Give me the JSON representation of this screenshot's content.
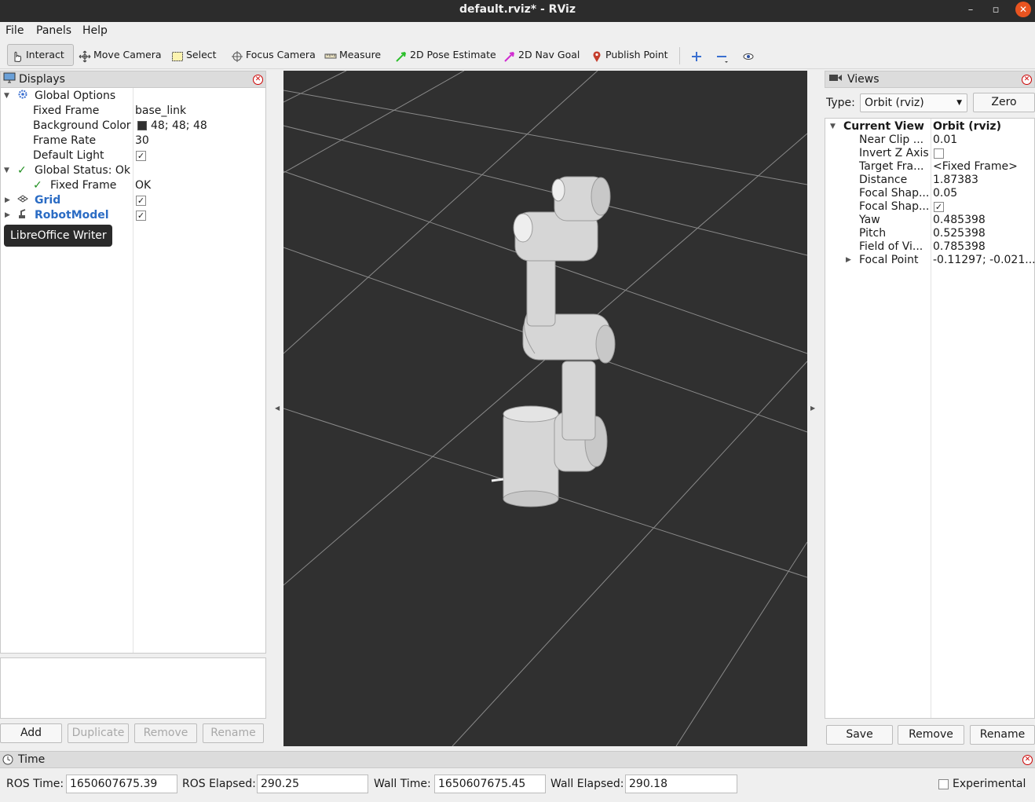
{
  "window": {
    "title": "default.rviz* - RViz",
    "minimize": "–",
    "maximize": "▫",
    "close": "✕"
  },
  "menu": {
    "file": "File",
    "panels": "Panels",
    "help": "Help"
  },
  "toolbar": {
    "interact": "Interact",
    "move_camera": "Move Camera",
    "select": "Select",
    "focus_camera": "Focus Camera",
    "measure": "Measure",
    "pose_estimate": "2D Pose Estimate",
    "nav_goal": "2D Nav Goal",
    "publish_point": "Publish Point"
  },
  "displays": {
    "title": "Displays",
    "rows": {
      "global_options": "Global Options",
      "fixed_frame_label": "Fixed Frame",
      "fixed_frame_value": "base_link",
      "bg_color_label": "Background Color",
      "bg_color_value": "48; 48; 48",
      "frame_rate_label": "Frame Rate",
      "frame_rate_value": "30",
      "default_light_label": "Default Light",
      "global_status": "Global Status: Ok",
      "status_fixed_frame_label": "Fixed Frame",
      "status_fixed_frame_value": "OK",
      "grid": "Grid",
      "robot_model": "RobotModel"
    },
    "tooltip": "LibreOffice Writer",
    "buttons": {
      "add": "Add",
      "duplicate": "Duplicate",
      "remove": "Remove",
      "rename": "Rename"
    }
  },
  "views": {
    "title": "Views",
    "type_label": "Type:",
    "type_value": "Orbit (rviz)",
    "zero": "Zero",
    "current_view_label": "Current View",
    "current_view_value": "Orbit (rviz)",
    "props": [
      {
        "k": "Near Clip ...",
        "v": "0.01"
      },
      {
        "k": "Invert Z Axis",
        "v": ""
      },
      {
        "k": "Target Fra...",
        "v": "<Fixed Frame>"
      },
      {
        "k": "Distance",
        "v": "1.87383"
      },
      {
        "k": "Focal Shap...",
        "v": "0.05"
      },
      {
        "k": "Focal Shap...",
        "v": ""
      },
      {
        "k": "Yaw",
        "v": "0.485398"
      },
      {
        "k": "Pitch",
        "v": "0.525398"
      },
      {
        "k": "Field of Vi...",
        "v": "0.785398"
      },
      {
        "k": "Focal Point",
        "v": "-0.11297; -0.021..."
      }
    ],
    "buttons": {
      "save": "Save",
      "remove": "Remove",
      "rename": "Rename"
    }
  },
  "time": {
    "title": "Time",
    "ros_time_label": "ROS Time:",
    "ros_time": "1650607675.39",
    "ros_elapsed_label": "ROS Elapsed:",
    "ros_elapsed": "290.25",
    "wall_time_label": "Wall Time:",
    "wall_time": "1650607675.45",
    "wall_elapsed_label": "Wall Elapsed:",
    "wall_elapsed": "290.18",
    "experimental": "Experimental"
  },
  "colors": {
    "viewport_bg": "#303030",
    "accent_close": "#e95420",
    "link_blue": "#2b6cc4"
  },
  "checkmark": "✓"
}
